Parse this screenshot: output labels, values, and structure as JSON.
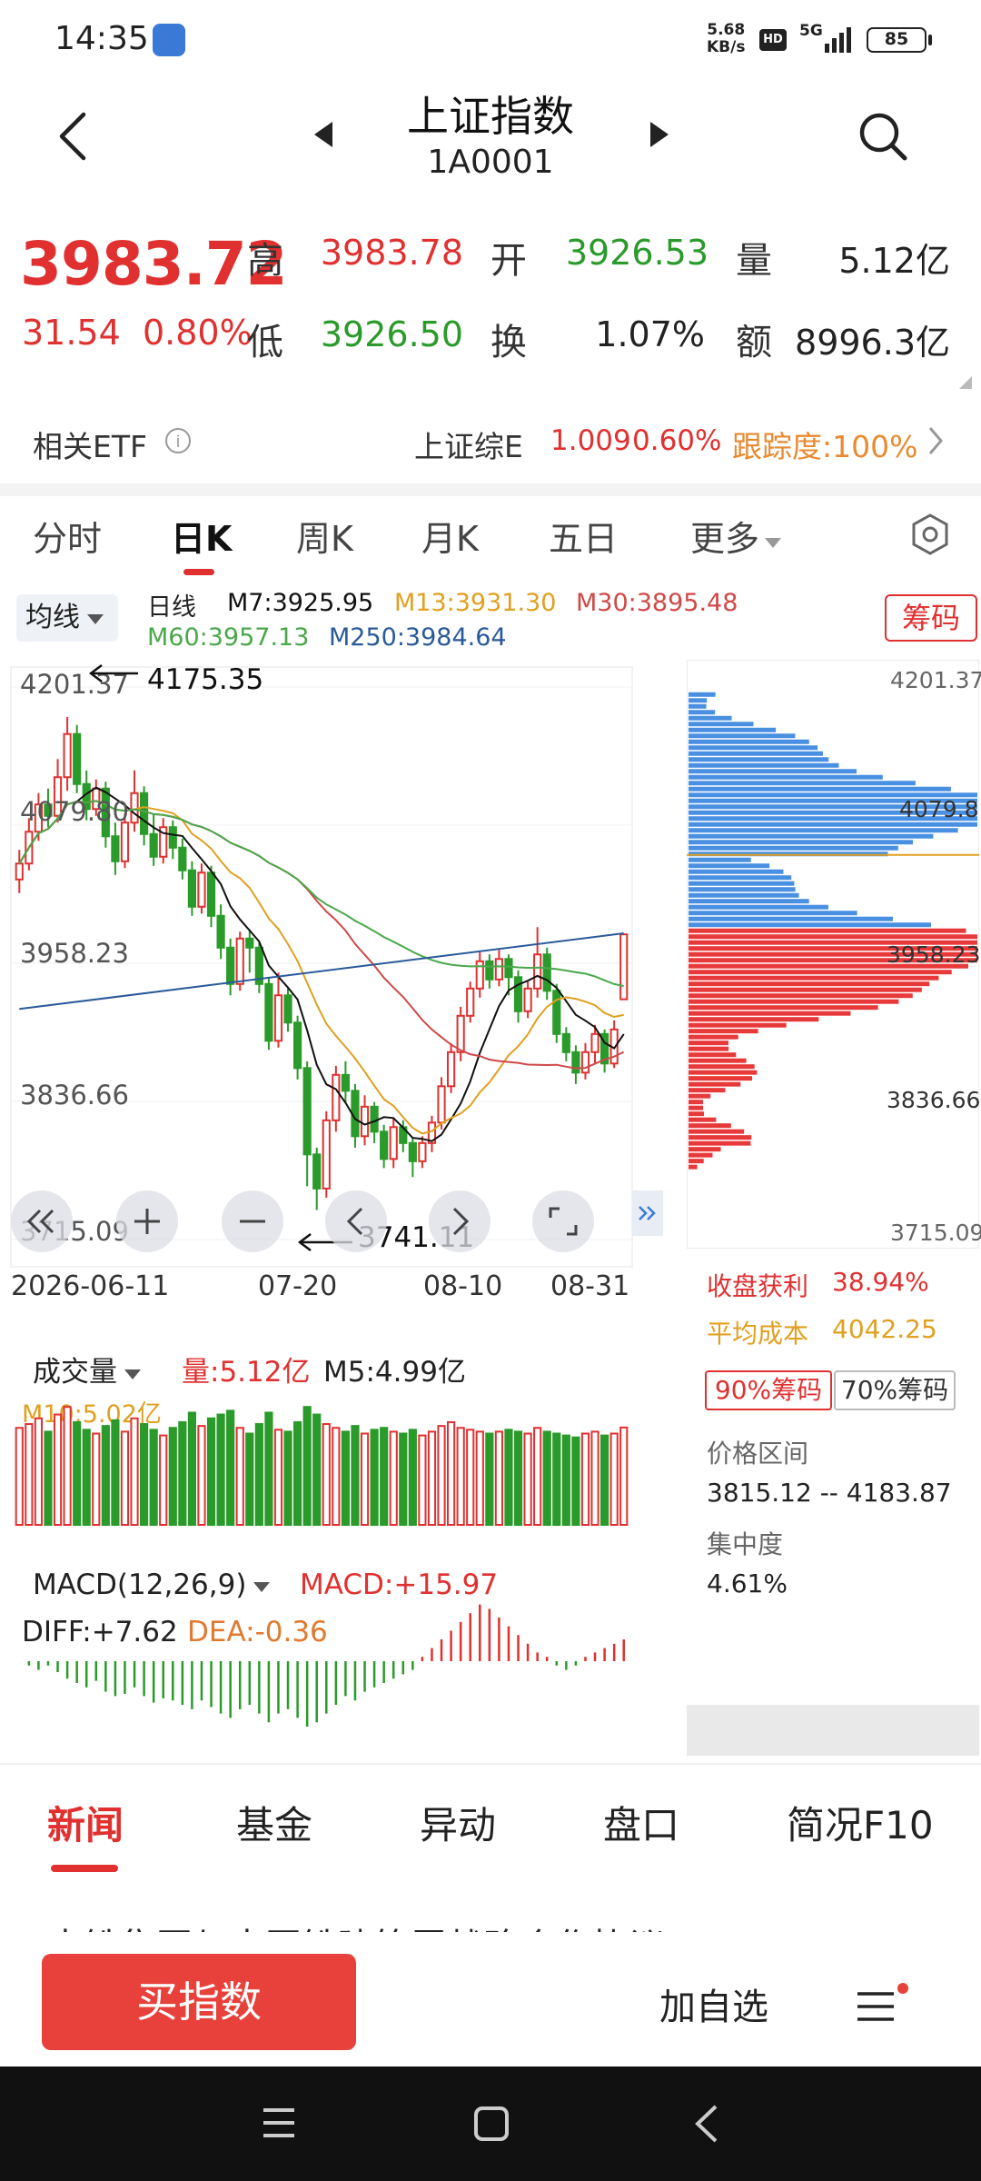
{
  "status_bar": {
    "time": "14:35",
    "net_speed_value": "5.68",
    "net_speed_unit": "KB/s",
    "hd": "HD",
    "network": "5G",
    "battery": "85"
  },
  "header": {
    "title": "上证指数",
    "code": "1A0001"
  },
  "quote": {
    "price": "3983.72",
    "change": "31.54",
    "change_pct": "0.80%",
    "high_label": "高",
    "high": "3983.78",
    "open_label": "开",
    "open": "3926.53",
    "volume_label": "量",
    "volume": "5.12亿",
    "low_label": "低",
    "low": "3926.50",
    "turnover_label": "换",
    "turnover": "1.07%",
    "amount_label": "额",
    "amount": "8996.3亿"
  },
  "etf": {
    "label": "相关ETF",
    "name": "上证综E",
    "price": "1.009",
    "pct": "0.60%",
    "tracking": "跟踪度:100%"
  },
  "chart_tabs": [
    "分时",
    "日K",
    "周K",
    "月K",
    "五日",
    "更多"
  ],
  "ma_select": "均线",
  "ma_legend": {
    "period": "日线",
    "m7": "M7:3925.95",
    "m13": "M13:3931.30",
    "m30": "M30:3895.48",
    "m60": "M60:3957.13",
    "m250": "M250:3984.64"
  },
  "chip_button": "筹码",
  "price_axis": [
    "4201.37",
    "4079.80",
    "3958.23",
    "3836.66",
    "3715.09"
  ],
  "chip_axis": [
    "4201.37",
    "4079.8",
    "3958.23",
    "3836.66",
    "3715.09"
  ],
  "high_marker": "4175.35",
  "low_marker": "3741.11",
  "dates": [
    "2026-06-11",
    "07-20",
    "08-10",
    "08-31"
  ],
  "chip_stats": {
    "profit_label": "收盘获利",
    "profit": "38.94%",
    "avg_label": "平均成本",
    "avg": "4042.25",
    "pct90": "90%筹码",
    "pct70": "70%筹码",
    "range_label": "价格区间",
    "range": "3815.12 -- 4183.87",
    "conc_label": "集中度",
    "conc": "4.61%"
  },
  "volume_legend": {
    "label": "成交量",
    "vol": "量:5.12亿",
    "m5": "M5:4.99亿",
    "m10": "M10:5.02亿"
  },
  "macd_legend": {
    "label": "MACD(12,26,9)",
    "macd": "MACD:+15.97",
    "diff": "DIFF:+7.62",
    "dea": "DEA:-0.36"
  },
  "bottom_tabs": [
    "新闻",
    "基金",
    "异动",
    "盘口",
    "简况F10"
  ],
  "news_peek": "中铁集团与中国铁建签署战略合作协议",
  "actions": {
    "buy": "买指数",
    "watch": "加自选"
  },
  "colors": {
    "up": "#e03030",
    "down": "#2a9a2a",
    "m7": "#111111",
    "m13": "#e0a020",
    "m30": "#d04848",
    "m60": "#4aa84a",
    "m250": "#2a5a9a",
    "chip_profit": "#4a90e2",
    "chip_loss": "#e8393a"
  },
  "chart_data": {
    "type": "candlestick",
    "ylim": [
      3715.09,
      4201.37
    ],
    "y_ticks": [
      4201.37,
      4079.8,
      3958.23,
      3836.66,
      3715.09
    ],
    "x_ticks": [
      "2026-06-11",
      "07-20",
      "08-10",
      "08-31"
    ],
    "candles": [
      [
        4032,
        4046,
        4020,
        4058
      ],
      [
        4046,
        4074,
        4040,
        4086
      ],
      [
        4074,
        4098,
        4066,
        4108
      ],
      [
        4098,
        4088,
        4078,
        4112
      ],
      [
        4088,
        4122,
        4082,
        4138
      ],
      [
        4122,
        4160,
        4110,
        4175
      ],
      [
        4160,
        4116,
        4108,
        4168
      ],
      [
        4116,
        4094,
        4084,
        4128
      ],
      [
        4094,
        4112,
        4088,
        4120
      ],
      [
        4112,
        4070,
        4060,
        4118
      ],
      [
        4070,
        4048,
        4036,
        4082
      ],
      [
        4048,
        4082,
        4042,
        4090
      ],
      [
        4082,
        4108,
        4074,
        4128
      ],
      [
        4108,
        4072,
        4062,
        4114
      ],
      [
        4072,
        4052,
        4044,
        4090
      ],
      [
        4052,
        4078,
        4046,
        4086
      ],
      [
        4078,
        4060,
        4050,
        4084
      ],
      [
        4060,
        4040,
        4032,
        4068
      ],
      [
        4040,
        4008,
        4000,
        4048
      ],
      [
        4008,
        4038,
        4002,
        4046
      ],
      [
        4038,
        4000,
        3990,
        4044
      ],
      [
        4000,
        3972,
        3962,
        4010
      ],
      [
        3972,
        3940,
        3930,
        3980
      ],
      [
        3940,
        3980,
        3934,
        3986
      ],
      [
        3980,
        3972,
        3950,
        3988
      ],
      [
        3972,
        3940,
        3932,
        3978
      ],
      [
        3940,
        3890,
        3882,
        3946
      ],
      [
        3890,
        3930,
        3884,
        3950
      ],
      [
        3930,
        3906,
        3898,
        3936
      ],
      [
        3906,
        3866,
        3856,
        3912
      ],
      [
        3866,
        3790,
        3762,
        3872
      ],
      [
        3790,
        3760,
        3741.11,
        3796
      ],
      [
        3760,
        3820,
        3752,
        3828
      ],
      [
        3820,
        3860,
        3810,
        3868
      ],
      [
        3860,
        3846,
        3836,
        3872
      ],
      [
        3846,
        3806,
        3796,
        3852
      ],
      [
        3806,
        3832,
        3798,
        3842
      ],
      [
        3832,
        3810,
        3800,
        3836
      ],
      [
        3810,
        3786,
        3778,
        3816
      ],
      [
        3786,
        3814,
        3778,
        3822
      ],
      [
        3814,
        3800,
        3792,
        3820
      ],
      [
        3800,
        3784,
        3770,
        3804
      ],
      [
        3784,
        3800,
        3778,
        3806
      ],
      [
        3800,
        3818,
        3792,
        3824
      ],
      [
        3818,
        3850,
        3812,
        3858
      ],
      [
        3850,
        3880,
        3844,
        3888
      ],
      [
        3880,
        3912,
        3872,
        3920
      ],
      [
        3912,
        3936,
        3906,
        3942
      ],
      [
        3936,
        3960,
        3928,
        3968
      ],
      [
        3960,
        3944,
        3936,
        3966
      ],
      [
        3944,
        3962,
        3938,
        3970
      ],
      [
        3962,
        3946,
        3930,
        3966
      ],
      [
        3946,
        3916,
        3906,
        3952
      ],
      [
        3916,
        3936,
        3910,
        3942
      ],
      [
        3936,
        3966,
        3928,
        3990
      ],
      [
        3966,
        3934,
        3926,
        3972
      ],
      [
        3934,
        3896,
        3888,
        3940
      ],
      [
        3896,
        3880,
        3872,
        3902
      ],
      [
        3880,
        3862,
        3852,
        3886
      ],
      [
        3862,
        3880,
        3856,
        3888
      ],
      [
        3880,
        3896,
        3870,
        3904
      ],
      [
        3896,
        3870,
        3862,
        3900
      ],
      [
        3870,
        3900,
        3866,
        3908
      ],
      [
        3926.53,
        3983.72,
        3926.5,
        3983.78
      ]
    ],
    "volume": [
      5.1,
      5.3,
      5.6,
      4.9,
      5.8,
      6.2,
      5.4,
      5.0,
      4.8,
      5.2,
      5.5,
      4.9,
      5.6,
      5.3,
      5.0,
      4.7,
      5.1,
      5.4,
      5.9,
      5.2,
      5.6,
      5.8,
      6.0,
      5.1,
      4.8,
      5.3,
      5.9,
      5.0,
      4.9,
      5.4,
      6.2,
      5.8,
      5.3,
      5.1,
      4.9,
      5.2,
      4.8,
      5.0,
      5.1,
      4.9,
      4.8,
      5.0,
      4.7,
      4.9,
      5.2,
      5.4,
      5.1,
      5.0,
      4.9,
      4.8,
      4.9,
      5.0,
      4.9,
      4.8,
      5.1,
      4.9,
      4.8,
      4.7,
      4.6,
      4.8,
      4.9,
      4.7,
      4.8,
      5.12
    ],
    "macd_hist": [
      0,
      -2,
      -4,
      -2,
      -5,
      -8,
      -10,
      -12,
      -9,
      -14,
      -16,
      -15,
      -12,
      -16,
      -19,
      -17,
      -18,
      -20,
      -22,
      -18,
      -21,
      -24,
      -26,
      -22,
      -20,
      -24,
      -28,
      -24,
      -22,
      -26,
      -30,
      -28,
      -24,
      -20,
      -16,
      -18,
      -14,
      -12,
      -10,
      -8,
      -6,
      -4,
      2,
      6,
      10,
      14,
      18,
      22,
      26,
      24,
      20,
      16,
      12,
      8,
      4,
      2,
      -2,
      -4,
      -2,
      2,
      4,
      6,
      8,
      10
    ]
  }
}
